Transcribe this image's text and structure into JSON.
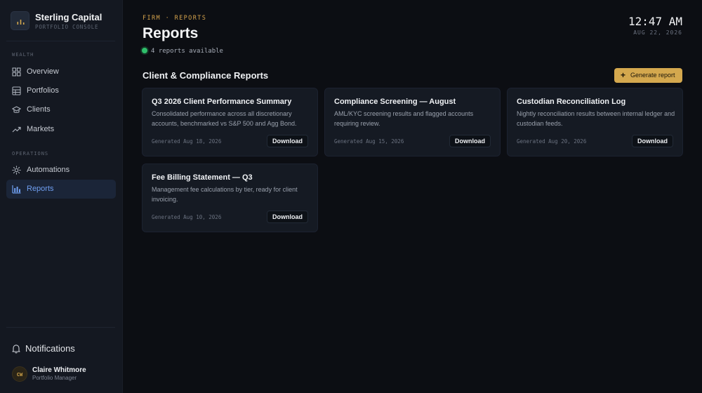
{
  "brand": {
    "name": "Sterling Capital",
    "subtitle": "PORTFOLIO CONSOLE"
  },
  "sidebar": {
    "sections": [
      {
        "label": "WEALTH",
        "items": [
          {
            "label": "Overview",
            "icon": "grid-icon"
          },
          {
            "label": "Portfolios",
            "icon": "table-icon"
          },
          {
            "label": "Clients",
            "icon": "graduation-cap-icon"
          },
          {
            "label": "Markets",
            "icon": "trending-up-icon"
          }
        ]
      },
      {
        "label": "OPERATIONS",
        "items": [
          {
            "label": "Automations",
            "icon": "sun-gear-icon"
          },
          {
            "label": "Reports",
            "icon": "bar-chart-icon",
            "active": true
          }
        ]
      }
    ],
    "notifications_label": "Notifications",
    "user": {
      "initials": "CW",
      "name": "Claire Whitmore",
      "role": "Portfolio Manager"
    }
  },
  "header": {
    "breadcrumb": "FIRM · REPORTS",
    "title": "Reports",
    "status": "4 reports available",
    "time": "12:47 AM",
    "date": "AUG 22, 2026"
  },
  "section": {
    "title": "Client & Compliance Reports",
    "generate_label": "Generate report"
  },
  "reports": [
    {
      "title": "Q3 2026 Client Performance Summary",
      "description": "Consolidated performance across all discretionary accounts, benchmarked vs S&P 500 and Agg Bond.",
      "generated": "Generated Aug 18, 2026",
      "action": "Download"
    },
    {
      "title": "Compliance Screening — August",
      "description": "AML/KYC screening results and flagged accounts requiring review.",
      "generated": "Generated Aug 15, 2026",
      "action": "Download"
    },
    {
      "title": "Custodian Reconciliation Log",
      "description": "Nightly reconciliation results between internal ledger and custodian feeds.",
      "generated": "Generated Aug 20, 2026",
      "action": "Download"
    },
    {
      "title": "Fee Billing Statement — Q3",
      "description": "Management fee calculations by tier, ready for client invoicing.",
      "generated": "Generated Aug 10, 2026",
      "action": "Download"
    }
  ],
  "colors": {
    "accent_gold": "#d4a84e",
    "active_blue": "#6f9ef0",
    "status_green": "#2fbf6b",
    "background": "#0c0e13",
    "sidebar": "#141821"
  }
}
